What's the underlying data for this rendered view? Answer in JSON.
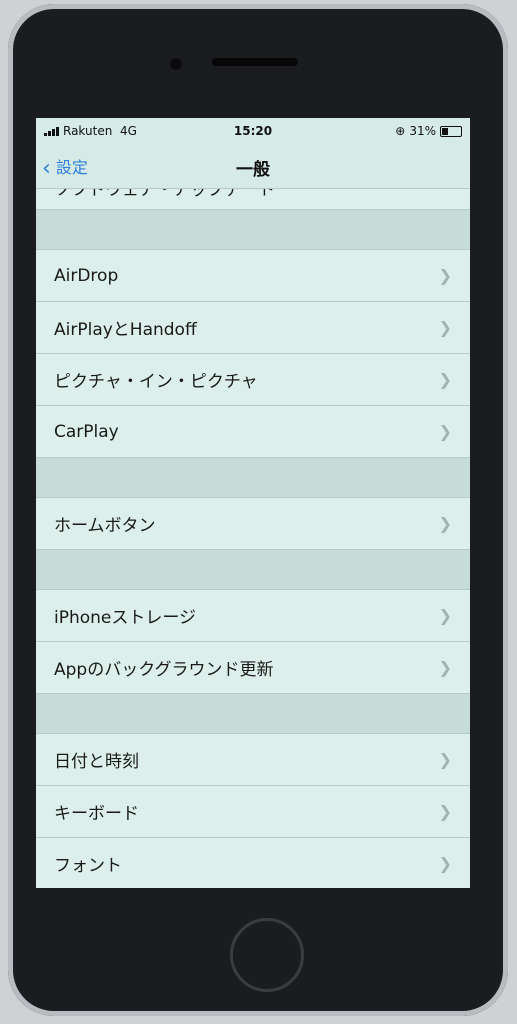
{
  "status": {
    "carrier": "Rakuten",
    "network": "4G",
    "time": "15:20",
    "battery": "31%",
    "battery_level": 0.31
  },
  "nav": {
    "back_label": "設定",
    "title": "一般"
  },
  "partial_row": "ソフトウェア・アップデート",
  "groups": [
    [
      "AirDrop",
      "AirPlayとHandoff",
      "ピクチャ・イン・ピクチャ",
      "CarPlay"
    ],
    [
      "ホームボタン"
    ],
    [
      "iPhoneストレージ",
      "Appのバックグラウンド更新"
    ],
    [
      "日付と時刻",
      "キーボード",
      "フォント"
    ]
  ]
}
